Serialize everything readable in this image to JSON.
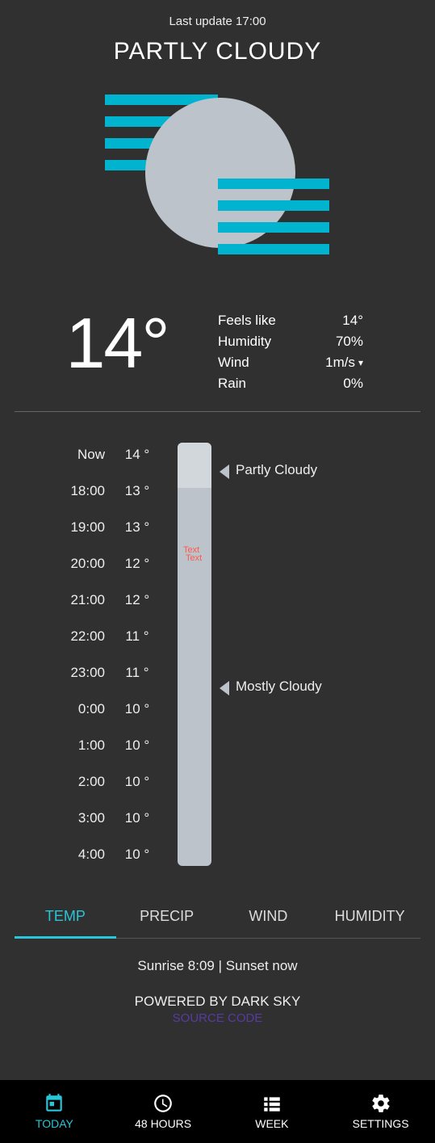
{
  "header": {
    "last_update": "Last update 17:00",
    "condition": "PARTLY CLOUDY"
  },
  "current": {
    "temp": "14°",
    "details": {
      "feels_like_label": "Feels like",
      "feels_like_val": "14°",
      "humidity_label": "Humidity",
      "humidity_val": "70%",
      "wind_label": "Wind",
      "wind_val": "1m/s",
      "rain_label": "Rain",
      "rain_val": "0%"
    }
  },
  "hourly": {
    "rows": [
      {
        "time": "Now",
        "val": "14 °"
      },
      {
        "time": "18:00",
        "val": "13 °"
      },
      {
        "time": "19:00",
        "val": "13 °"
      },
      {
        "time": "20:00",
        "val": "12 °"
      },
      {
        "time": "21:00",
        "val": "12 °"
      },
      {
        "time": "22:00",
        "val": "11 °"
      },
      {
        "time": "23:00",
        "val": "11 °"
      },
      {
        "time": "0:00",
        "val": "10 °"
      },
      {
        "time": "1:00",
        "val": "10 °"
      },
      {
        "time": "2:00",
        "val": "10 °"
      },
      {
        "time": "3:00",
        "val": "10 °"
      },
      {
        "time": "4:00",
        "val": "10 °"
      }
    ],
    "bar_text1": "Text",
    "bar_text2": "Text",
    "desc1": "Partly Cloudy",
    "desc2": "Mostly Cloudy"
  },
  "metric_tabs": {
    "temp": "TEMP",
    "precip": "PRECIP",
    "wind": "WIND",
    "humidity": "HUMIDITY"
  },
  "footer": {
    "sun": "Sunrise 8:09 | Sunset now",
    "powered": "POWERED BY DARK SKY",
    "source": "SOURCE CODE"
  },
  "nav": {
    "today": "TODAY",
    "hours48": "48 HOURS",
    "week": "WEEK",
    "settings": "SETTINGS"
  }
}
